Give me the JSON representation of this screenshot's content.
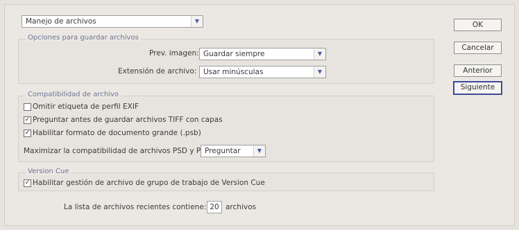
{
  "preset": {
    "value": "Manejo de archivos"
  },
  "save_options": {
    "legend": "Opciones para guardar archivos",
    "preview_label": "Prev. imagen:",
    "preview_value": "Guardar siempre",
    "extension_label": "Extensión de archivo:",
    "extension_value": "Usar minúsculas"
  },
  "compat": {
    "legend": "Compatibilidad de archivo",
    "options": [
      {
        "label": "Omitir etiqueta de perfil EXIF",
        "checked": false
      },
      {
        "label": "Preguntar antes de guardar archivos TIFF con capas",
        "checked": true
      },
      {
        "label": "Habilitar formato de documento grande (.psb)",
        "checked": true
      }
    ],
    "maximize_label": "Maximizar la compatibilidad de archivos PSD y PSB:",
    "maximize_value": "Preguntar"
  },
  "version_cue": {
    "legend": "Version Cue",
    "option_label": "Habilitar gestión de archivo de grupo de trabajo de Version Cue",
    "checked": true
  },
  "recent": {
    "label_before": "La lista de archivos recientes contiene:",
    "count": "20",
    "label_after": "archivos"
  },
  "buttons": {
    "ok": "OK",
    "cancel": "Cancelar",
    "previous": "Anterior",
    "next": "Siguiente"
  },
  "glyphs": {
    "checkmark": "✓",
    "dropdown": "▼"
  }
}
